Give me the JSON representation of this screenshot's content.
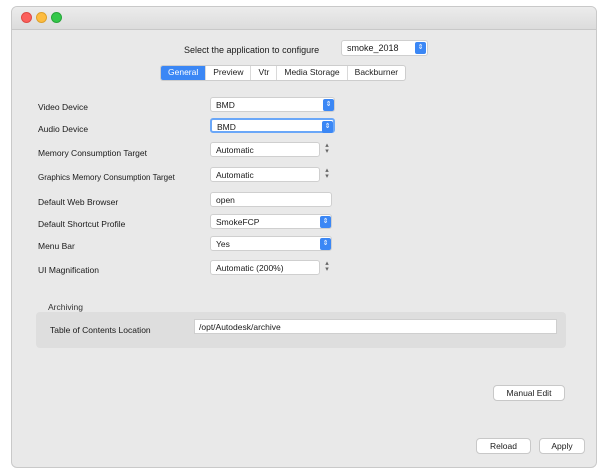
{
  "window": {
    "controls": [
      "close",
      "minimize",
      "zoom"
    ]
  },
  "app_selector": {
    "label": "Select the application to configure",
    "value": "smoke_2018"
  },
  "tabs": [
    {
      "label": "General",
      "active": true
    },
    {
      "label": "Preview",
      "active": false
    },
    {
      "label": "Vtr",
      "active": false
    },
    {
      "label": "Media Storage",
      "active": false
    },
    {
      "label": "Backburner",
      "active": false
    }
  ],
  "settings": [
    {
      "label": "Video Device",
      "value": "BMD",
      "control": "select"
    },
    {
      "label": "Audio Device",
      "value": "BMD",
      "control": "select"
    },
    {
      "label": "Memory Consumption Target",
      "value": "Automatic",
      "control": "stepper"
    },
    {
      "label": "Graphics Memory Consumption Target",
      "value": "Automatic",
      "control": "stepper"
    },
    {
      "label": "Default Web Browser",
      "value": "open",
      "control": "text"
    },
    {
      "label": "Default Shortcut Profile",
      "value": "SmokeFCP",
      "control": "select"
    },
    {
      "label": "Menu Bar",
      "value": "Yes",
      "control": "select"
    },
    {
      "label": "UI Magnification",
      "value": "Automatic (200%)",
      "control": "stepper"
    }
  ],
  "archiving": {
    "section_label": "Archiving",
    "toc_label": "Table of Contents Location",
    "toc_value": "/opt/Autodesk/archive"
  },
  "buttons": {
    "manual_edit": "Manual Edit",
    "reload": "Reload",
    "apply": "Apply"
  },
  "colors": {
    "accent": "#3b87f5",
    "window_bg": "#e9e9e9"
  }
}
